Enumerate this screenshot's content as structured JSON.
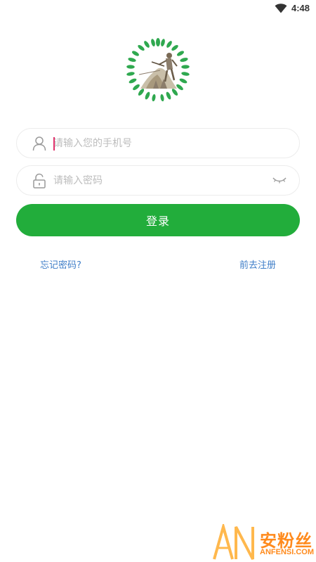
{
  "status_bar": {
    "time": "4:48",
    "wifi_icon": "wifi-icon"
  },
  "logo": {
    "icon": "farmer-wreath-logo",
    "colors": {
      "wreath": "#2fa84f",
      "figure": "#8b7d6b"
    }
  },
  "phone_field": {
    "icon": "user-icon",
    "placeholder": "请输入您的手机号",
    "value": ""
  },
  "password_field": {
    "icon": "lock-icon",
    "placeholder": "请输入密码",
    "value": "",
    "toggle_icon": "eye-closed-icon"
  },
  "login_button": {
    "label": "登录",
    "color": "#22ad3b"
  },
  "links": {
    "forgot": "忘记密码?",
    "register": "前去注册",
    "color": "#3f7ec8"
  },
  "watermark": {
    "letters": "AN",
    "text_cn": "安粉丝",
    "text_en": "ANFENSI.COM",
    "color": "#ff8a1c"
  }
}
